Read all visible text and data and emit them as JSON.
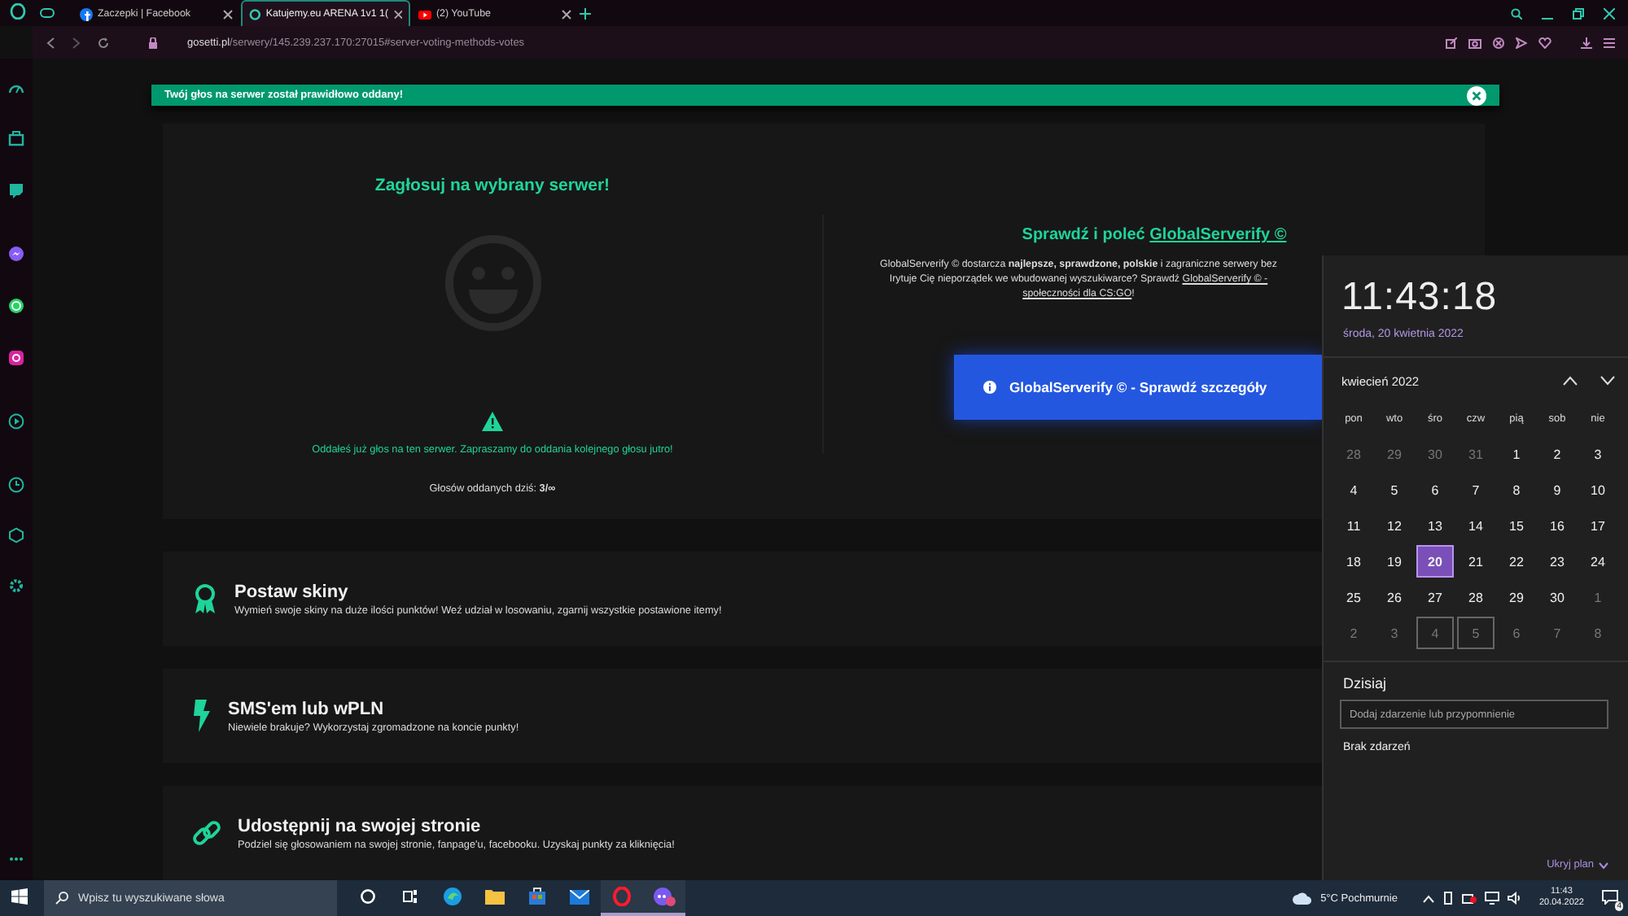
{
  "browser": {
    "tabs": [
      {
        "title": "Zaczepki | Facebook",
        "selected": false,
        "kind": "square"
      },
      {
        "title": "Katujemy.eu ARENA 1v1 1(",
        "selected": true,
        "kind": "ring"
      },
      {
        "title": "(2) YouTube",
        "selected": false,
        "kind": "play"
      }
    ],
    "url_host": "gosetti.pl",
    "url_path": "/serwery/145.239.237.170:27015#server-voting-methods-votes"
  },
  "toast": {
    "message": "Twój głos na serwer został prawidłowo oddany!"
  },
  "vote": {
    "title": "Zagłosuj na wybrany serwer!",
    "notice": "Oddałeś już głos na ten serwer. Zapraszamy do oddania kolejnego głosu jutro!",
    "count": "Głosów oddanych dziś: **3/∞**"
  },
  "promo": {
    "heading": "Sprawdź i poleć",
    "heading_link": "GlobalServerify ©",
    "lines": [
      {
        "text": "GlobalServerify © dostarcza **najlepsze, sprawdzone, polskie** i zagraniczne serwery bez"
      },
      {
        "text": "Irytuje Cię nieporządek we wbudowanej wyszukiwarce? Sprawdź",
        "link": "GlobalServerify © -"
      },
      {
        "link": "społeczności dla CS:GO",
        "after": "!"
      }
    ],
    "button": "GlobalServerify © - Sprawdź szczegóły"
  },
  "methods": [
    {
      "kind": "award",
      "title": "Postaw skiny",
      "description": "Wymień swoje skiny na duże ilości punktów! Weź udział w losowaniu, zgarnij wszystkie postawione itemy!"
    },
    {
      "kind": "bolt",
      "title": "SMS'em lub wPLN",
      "description": "Niewiele brakuje? Wykorzystaj zgromadzone na koncie punkty!"
    },
    {
      "kind": "link",
      "title": "Udostępnij na swojej stronie",
      "description": "Podziel się głosowaniem na swojej stronie, fanpage'u, facebooku. Uzyskaj punkty za kliknięcia!"
    }
  ],
  "calendar": {
    "time": "11:43:18",
    "date": "środa, 20 kwietnia 2022",
    "month": "kwiecień 2022",
    "weekdays": [
      "pon",
      "wto",
      "śro",
      "czw",
      "pią",
      "sob",
      "nie"
    ],
    "days": [
      {
        "label": "28",
        "other_month": true,
        "selected": false,
        "outlined": false
      },
      {
        "label": "29",
        "other_month": true,
        "selected": false,
        "outlined": false
      },
      {
        "label": "30",
        "other_month": true,
        "selected": false,
        "outlined": false
      },
      {
        "label": "31",
        "other_month": true,
        "selected": false,
        "outlined": false
      },
      {
        "label": "1",
        "other_month": false,
        "selected": false,
        "outlined": false
      },
      {
        "label": "2",
        "other_month": false,
        "selected": false,
        "outlined": false
      },
      {
        "label": "3",
        "other_month": false,
        "selected": false,
        "outlined": false
      },
      {
        "label": "4",
        "other_month": false,
        "selected": false,
        "outlined": false
      },
      {
        "label": "5",
        "other_month": false,
        "selected": false,
        "outlined": false
      },
      {
        "label": "6",
        "other_month": false,
        "selected": false,
        "outlined": false
      },
      {
        "label": "7",
        "other_month": false,
        "selected": false,
        "outlined": false
      },
      {
        "label": "8",
        "other_month": false,
        "selected": false,
        "outlined": false
      },
      {
        "label": "9",
        "other_month": false,
        "selected": false,
        "outlined": false
      },
      {
        "label": "10",
        "other_month": false,
        "selected": false,
        "outlined": false
      },
      {
        "label": "11",
        "other_month": false,
        "selected": false,
        "outlined": false
      },
      {
        "label": "12",
        "other_month": false,
        "selected": false,
        "outlined": false
      },
      {
        "label": "13",
        "other_month": false,
        "selected": false,
        "outlined": false
      },
      {
        "label": "14",
        "other_month": false,
        "selected": false,
        "outlined": false
      },
      {
        "label": "15",
        "other_month": false,
        "selected": false,
        "outlined": false
      },
      {
        "label": "16",
        "other_month": false,
        "selected": false,
        "outlined": false
      },
      {
        "label": "17",
        "other_month": false,
        "selected": false,
        "outlined": false
      },
      {
        "label": "18",
        "other_month": false,
        "selected": false,
        "outlined": false
      },
      {
        "label": "19",
        "other_month": false,
        "selected": false,
        "outlined": false
      },
      {
        "label": "20",
        "other_month": false,
        "selected": true,
        "outlined": false
      },
      {
        "label": "21",
        "other_month": false,
        "selected": false,
        "outlined": false
      },
      {
        "label": "22",
        "other_month": false,
        "selected": false,
        "outlined": false
      },
      {
        "label": "23",
        "other_month": false,
        "selected": false,
        "outlined": false
      },
      {
        "label": "24",
        "other_month": false,
        "selected": false,
        "outlined": false
      },
      {
        "label": "25",
        "other_month": false,
        "selected": false,
        "outlined": false
      },
      {
        "label": "26",
        "other_month": false,
        "selected": false,
        "outlined": false
      },
      {
        "label": "27",
        "other_month": false,
        "selected": false,
        "outlined": false
      },
      {
        "label": "28",
        "other_month": false,
        "selected": false,
        "outlined": false
      },
      {
        "label": "29",
        "other_month": false,
        "selected": false,
        "outlined": false
      },
      {
        "label": "30",
        "other_month": false,
        "selected": false,
        "outlined": false
      },
      {
        "label": "1",
        "other_month": true,
        "selected": false,
        "outlined": false
      },
      {
        "label": "2",
        "other_month": true,
        "selected": false,
        "outlined": false
      },
      {
        "label": "3",
        "other_month": true,
        "selected": false,
        "outlined": false
      },
      {
        "label": "4",
        "other_month": true,
        "selected": false,
        "outlined": true
      },
      {
        "label": "5",
        "other_month": true,
        "selected": false,
        "outlined": true
      },
      {
        "label": "6",
        "other_month": true,
        "selected": false,
        "outlined": false
      },
      {
        "label": "7",
        "other_month": true,
        "selected": false,
        "outlined": false
      },
      {
        "label": "8",
        "other_month": true,
        "selected": false,
        "outlined": false
      }
    ],
    "today_heading": "Dzisiaj",
    "event_placeholder": "Dodaj zdarzenie lub przypomnienie",
    "no_events": "Brak zdarzeń",
    "hide_plan": "Ukryj plan"
  },
  "taskbar": {
    "search_placeholder": "Wpisz tu wyszukiwane słowa",
    "apps": [
      {
        "kind": "circle",
        "running": false
      },
      {
        "kind": "split",
        "running": false
      },
      {
        "kind": "wave",
        "running": false
      },
      {
        "kind": "folder",
        "running": false
      },
      {
        "kind": "store",
        "running": false
      },
      {
        "kind": "mail",
        "running": false
      },
      {
        "kind": "ring",
        "running": true
      },
      {
        "kind": "chat",
        "running": true
      }
    ],
    "weather": "5°C Pochmurnie",
    "time": "11:43",
    "date": "20.04.2022",
    "notifications": "4"
  }
}
